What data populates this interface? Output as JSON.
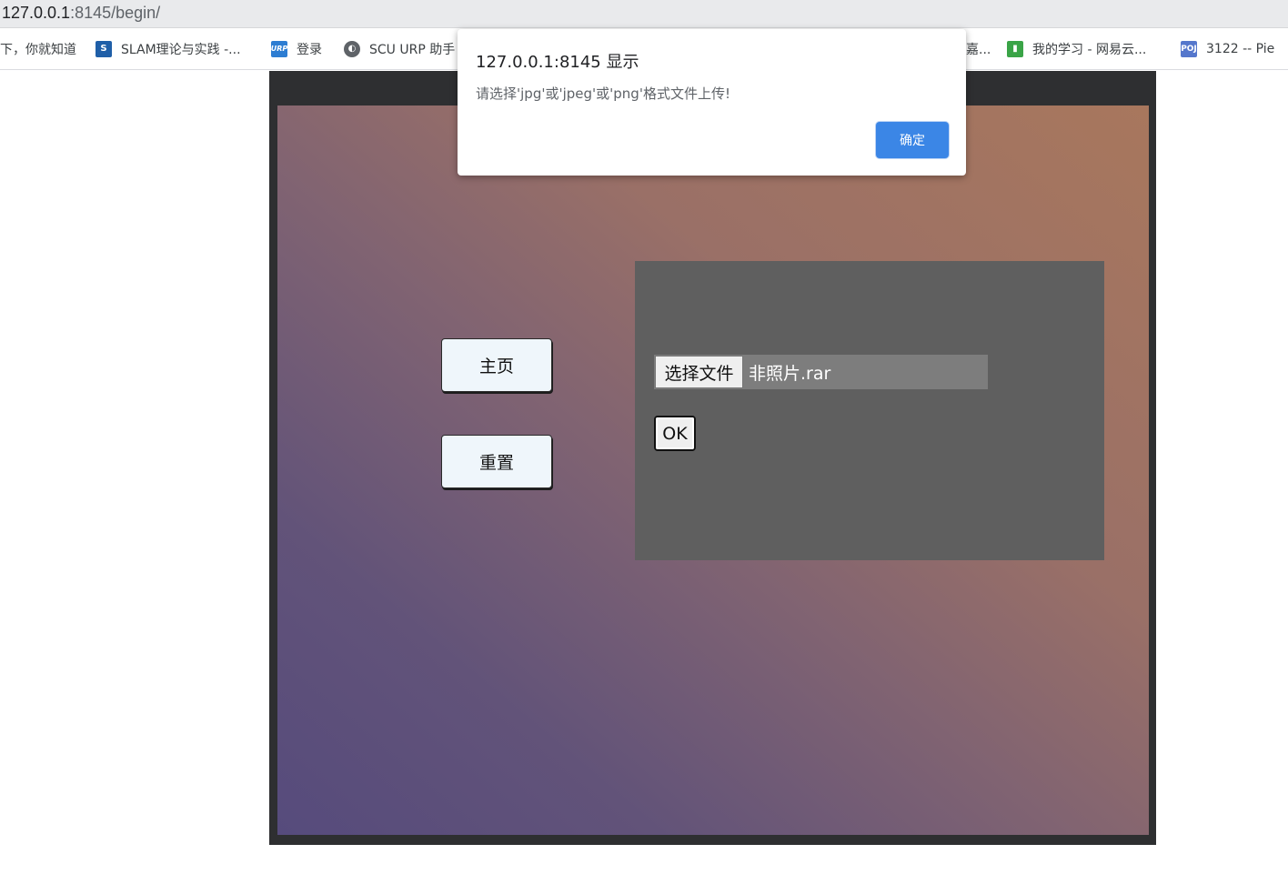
{
  "address_bar": {
    "host": "127.0.0.1",
    "path": ":8145/begin/"
  },
  "bookmarks": [
    {
      "label": "下，你就知道",
      "icon": "none"
    },
    {
      "label": "SLAM理论与实践 -...",
      "icon": "s-logo-icon"
    },
    {
      "label": "登录",
      "icon": "urp-logo-icon"
    },
    {
      "label": "SCU URP 助手",
      "icon": "globe-icon"
    },
    {
      "label": "嘉...",
      "icon": "none"
    },
    {
      "label": "我的学习 - 网易云...",
      "icon": "book-icon"
    },
    {
      "label": "3122 -- Pie",
      "icon": "poj-logo-icon"
    }
  ],
  "sidebar": {
    "home_label": "主页",
    "reset_label": "重置"
  },
  "upload": {
    "choose_file_label": "选择文件",
    "file_name": "非照片.rar",
    "submit_label": "OK"
  },
  "dialog": {
    "title": "127.0.0.1:8145 显示",
    "message": "请选择'jpg'或'jpeg'或'png'格式文件上传!",
    "confirm_label": "确定"
  },
  "colors": {
    "accent": "#3b86e6",
    "panel": "#5f5f5f",
    "frame": "#2e2f31"
  }
}
